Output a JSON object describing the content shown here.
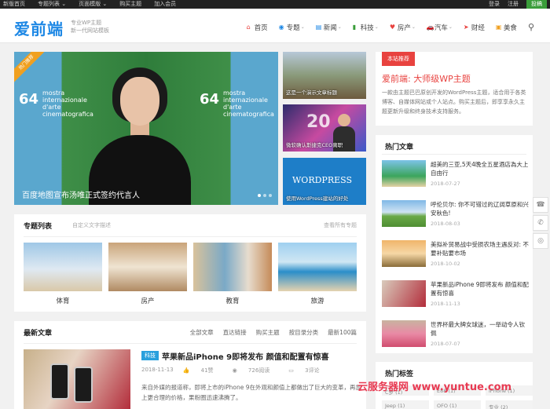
{
  "topbar": {
    "left": [
      "新版首页",
      "专题列表 ⌄",
      "页面模版 ⌄",
      "购买主题",
      "加入会员"
    ],
    "login": "登录",
    "register": "注册",
    "contribute": "投稿"
  },
  "header": {
    "logo": "爱前端",
    "tagline1": "专业WP主题",
    "tagline2": "新一代网站模板",
    "nav": [
      {
        "label": "首页",
        "icon": "home-icon"
      },
      {
        "label": "专题",
        "icon": "globe-icon",
        "dropdown": true
      },
      {
        "label": "新闻",
        "icon": "news-icon",
        "dropdown": true
      },
      {
        "label": "科技",
        "icon": "book-icon",
        "dropdown": true
      },
      {
        "label": "房产",
        "icon": "heart-icon",
        "dropdown": true
      },
      {
        "label": "汽车",
        "icon": "car-icon",
        "dropdown": true
      },
      {
        "label": "财经",
        "icon": "plane-icon"
      },
      {
        "label": "美食",
        "icon": "food-icon"
      }
    ]
  },
  "slider": {
    "caption": "百度地图宣布汤唯正式签约代言人",
    "ribbon": "热门推荐",
    "logo_number": "64",
    "logo_text": [
      "mostra",
      "internazionale",
      "d'arte",
      "cinematografica"
    ]
  },
  "thumbs": [
    {
      "caption": "这是一个演示文章标题"
    },
    {
      "caption": "微软确认斯捷克CEO离职"
    },
    {
      "caption": "使用WordPress建站的好处",
      "logo": "WORDPRESS"
    }
  ],
  "topics": {
    "title": "专题列表",
    "subtitle": "自定义文字描述",
    "more": "查看所有专题",
    "items": [
      "体育",
      "房产",
      "教育",
      "旅游"
    ]
  },
  "latest": {
    "title": "最新文章",
    "tabs": [
      "全部文章",
      "直达链接",
      "购买主题",
      "按目录分类",
      "最新100篇"
    ],
    "post": {
      "tag": "科技",
      "title": "苹果新品iPhone 9即将发布 颜值和配置有惊喜",
      "date": "2018-11-13",
      "likes": "41赞",
      "views": "726阅读",
      "comments": "3评论",
      "excerpt": "来自外媒的报道称，即将上市的iPhone 9在外观和颜值上都做出了巨大的变革，再加上更合理的价格，果粉圈迅速沸腾了。"
    }
  },
  "side": {
    "badge": "本站推荐",
    "title": "爱前端: 大师级WP主题",
    "desc": "一款由主题巴巴原创开发的WordPress主题，适合用于各类博客、自媒体网站或个人站点。购买主题后，即享享永久主题更新升级和终身技术支持服务。"
  },
  "hot": {
    "title": "热门文章",
    "items": [
      {
        "title": "超美的三亚,5天4晚全五星酒店為大上自由行",
        "date": "2018-07-27"
      },
      {
        "title": "呼伦贝尔: 你不可错过的辽阔草原和兴安秋色!",
        "date": "2018-08-03"
      },
      {
        "title": "美拟补贸易战中受损农场主遇反对: 不要补贴要市场",
        "date": "2018-10-02"
      },
      {
        "title": "苹果新品iPhone 9即将发布 颜值和配置有惊喜",
        "date": "2018-11-13"
      },
      {
        "title": "世界杯最大牌女球迷，一举动令人钦佩",
        "date": "2018-07-07"
      }
    ]
  },
  "tags": {
    "title": "热门标签",
    "items": [
      "C罗 (1)",
      "E88 (1)",
      "iPhone (1)",
      "Jeep (1)",
      "OFO (1)",
      "专业 (2)"
    ]
  },
  "watermark": "云服务器网 www.yuntue.com"
}
